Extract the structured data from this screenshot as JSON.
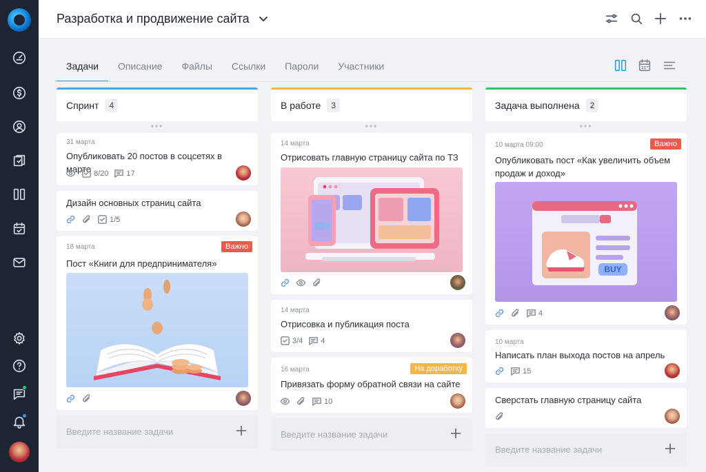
{
  "header": {
    "title": "Разработка и продвижение сайта"
  },
  "tabs": [
    {
      "label": "Задачи",
      "active": true
    },
    {
      "label": "Описание"
    },
    {
      "label": "Файлы"
    },
    {
      "label": "Ссылки"
    },
    {
      "label": "Пароли"
    },
    {
      "label": "Участники"
    }
  ],
  "colors": {
    "sprint": "#4aa3f0",
    "in_work": "#f4b740",
    "done": "#2ec66b",
    "important": "#f2594b",
    "rework": "#f9b549",
    "accent": "#2f9be8"
  },
  "columns": [
    {
      "title": "Спринт",
      "count": "4",
      "cards": [
        {
          "date": "31 марта",
          "title": "Опубликовать 20 постов в соцсетях в марте",
          "checklist": "8/20",
          "comments": "17"
        },
        {
          "title": "Дизайн основных страниц сайта",
          "checklist": "1/5"
        },
        {
          "date": "18 марта",
          "badge": "Важно",
          "title": "Пост «Книги для предпринимателя»"
        }
      ],
      "add_placeholder": "Введите название задачи"
    },
    {
      "title": "В работе",
      "count": "3",
      "cards": [
        {
          "date": "14 марта",
          "title": "Отрисовать главную страницу сайта по ТЗ"
        },
        {
          "date": "14 марта",
          "title": "Отрисовка и публикация поста",
          "checklist": "3/4",
          "comments": "4"
        },
        {
          "date": "16 марта",
          "badge": "На доработку",
          "title": "Привязать форму обратной связи на сайте",
          "comments": "10"
        }
      ],
      "add_placeholder": "Введите название задачи"
    },
    {
      "title": "Задача выполнена",
      "count": "2",
      "cards": [
        {
          "date": "10 марта 09:00",
          "badge": "Важно",
          "title": "Опубликовать пост «Как увеличить объем продаж и доход»",
          "image_text": "BUY",
          "comments": "4"
        },
        {
          "date": "10 марта",
          "title": "Написать план выхода постов на апрель",
          "comments": "15"
        },
        {
          "title": "Сверстать главную страницу сайта"
        }
      ],
      "add_placeholder": "Введите название задачи"
    }
  ]
}
